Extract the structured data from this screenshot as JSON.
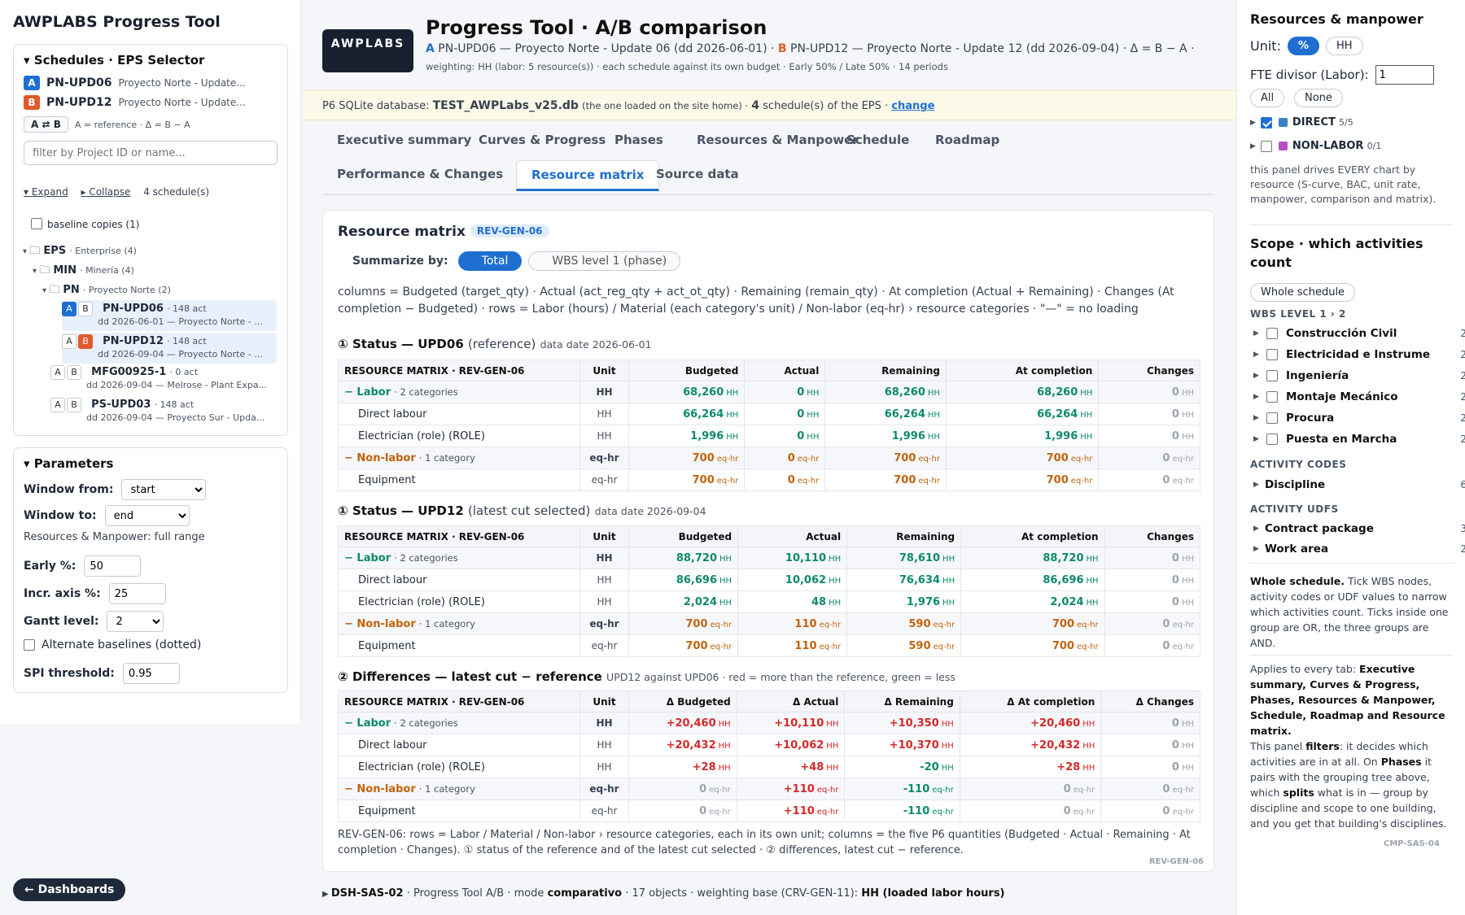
{
  "sidebar": {
    "app_title": "AWPLABS  Progress Tool",
    "schedules_title": "Schedules · EPS Selector",
    "sched_a": {
      "letter": "A",
      "id": "PN-UPD06",
      "name": "Proyecto Norte - Update..."
    },
    "sched_b": {
      "letter": "B",
      "id": "PN-UPD12",
      "name": "Proyecto Norte - Update..."
    },
    "swap_label": "A ⇄ B",
    "swap_legend": "A = reference · Δ = B − A",
    "filter_placeholder": "filter by Project ID or name...",
    "expand": "▾ Expand",
    "collapse": "▸ Collapse",
    "count": "4 schedule(s)",
    "baseline_copies": "baseline copies (1)",
    "tree": {
      "eps": {
        "name": "EPS",
        "sub": "· Enterprise (4)"
      },
      "min": {
        "name": "MIN",
        "sub": "· Minería (4)"
      },
      "pn": {
        "name": "PN",
        "sub": "· Proyecto Norte (2)"
      },
      "items": [
        {
          "id": "PN-UPD06",
          "acts": "· 148 act",
          "line2": "dd 2026-06-01 — Proyecto Norte - ..."
        },
        {
          "id": "PN-UPD12",
          "acts": "· 148 act",
          "line2": "dd 2026-09-04 — Proyecto Norte - ..."
        },
        {
          "id": "MFG00925-1",
          "acts": "· 0 act",
          "line2": "dd 2026-09-04 — Melrose - Plant Expa..."
        },
        {
          "id": "PS-UPD03",
          "acts": "· 148 act",
          "line2": "dd 2026-09-04 — Proyecto Sur - Upda..."
        }
      ]
    },
    "params_title": "Parameters",
    "window_from_label": "Window from:",
    "window_from_value": "start",
    "window_to_label": "Window to:",
    "window_to_value": "end",
    "range_note": "Resources & Manpower: full range",
    "early_label": "Early %:",
    "early_value": "50",
    "incr_label": "Incr. axis %:",
    "incr_value": "25",
    "gantt_label": "Gantt level:",
    "gantt_value": "2",
    "alt_baselines": "Alternate baselines (dotted)",
    "spi_label": "SPI threshold:",
    "spi_value": "0.95",
    "dashboards": "← Dashboards"
  },
  "header": {
    "logo": "AWPLABS",
    "title": "Progress Tool · A/B comparison",
    "sub_a_letter": "A",
    "sub_a": "PN-UPD06 — Proyecto Norte - Update 06 (dd 2026-06-01) ·",
    "sub_b_letter": "B",
    "sub_b": "PN-UPD12 — Proyecto Norte - Update 12 (dd 2026-09-04) · Δ = B − A ·",
    "sub2": "weighting: HH (labor: 5 resource(s)) · each schedule against its own budget · Early 50% / Late 50% · 14 periods",
    "db_prefix": "P6 SQLite database:",
    "db_name": "TEST_AWPLabs_v25.db",
    "db_note": "(the one loaded on the site home) ·",
    "db_count": "4",
    "db_count_suffix": "schedule(s) of the EPS ·",
    "db_change": "change"
  },
  "tabs": [
    "Executive summary",
    "Curves & Progress",
    "Phases",
    "Resources & Manpower",
    "Schedule",
    "Roadmap",
    "Performance & Changes",
    "Resource matrix",
    "Source data"
  ],
  "matrix": {
    "title": "Resource matrix",
    "tag": "REV-GEN-06",
    "summarize_label": "Summarize by:",
    "opt_total": "Total",
    "opt_wbs": "WBS level 1 (phase)",
    "desc": "columns = Budgeted (target_qty) · Actual (act_reg_qty + act_ot_qty) · Remaining (remain_qty) · At completion (Actual + Remaining) · Changes (At completion − Budgeted) · rows = Labor (hours) / Material (each category's unit) / Non-labor (eq-hr) › resource categories · \"—\" = no loading",
    "sec1": {
      "num": "①",
      "title": "Status — UPD06",
      "paren": "(reference)",
      "meta": "data date 2026-06-01"
    },
    "sec2": {
      "num": "①",
      "title": "Status — UPD12",
      "paren": "(latest cut selected)",
      "meta": "data date 2026-09-04"
    },
    "sec3": {
      "num": "②",
      "title": "Differences — latest cut − reference",
      "paren": "",
      "meta": "UPD12 against UPD06 · red = more than the reference, green = less"
    },
    "headers_status": [
      "RESOURCE MATRIX · REV-GEN-06",
      "Unit",
      "Budgeted",
      "Actual",
      "Remaining",
      "At completion",
      "Changes"
    ],
    "headers_diff": [
      "RESOURCE MATRIX · REV-GEN-06",
      "Unit",
      "Δ Budgeted",
      "Δ Actual",
      "Δ Remaining",
      "Δ At completion",
      "Δ Changes"
    ],
    "table1": [
      {
        "kind": "grp",
        "cls": "lab",
        "name": "Labor",
        "sub": "· 2 categories",
        "unit": "HH",
        "vals": [
          "68,260",
          "0",
          "68,260",
          "68,260",
          "0"
        ],
        "u": "HH",
        "colors": [
          "lab",
          "lab",
          "lab",
          "lab",
          "zero"
        ]
      },
      {
        "kind": "row",
        "name": "Direct labour",
        "unit": "HH",
        "vals": [
          "66,264",
          "0",
          "66,264",
          "66,264",
          "0"
        ],
        "u": "HH",
        "colors": [
          "lab",
          "lab",
          "lab",
          "lab",
          "zero"
        ]
      },
      {
        "kind": "row",
        "name": "Electrician (role) (ROLE)",
        "unit": "HH",
        "vals": [
          "1,996",
          "0",
          "1,996",
          "1,996",
          "0"
        ],
        "u": "HH",
        "colors": [
          "lab",
          "lab",
          "lab",
          "lab",
          "zero"
        ]
      },
      {
        "kind": "grp",
        "cls": "non",
        "name": "Non-labor",
        "sub": "· 1 category",
        "unit": "eq-hr",
        "vals": [
          "700",
          "0",
          "700",
          "700",
          "0"
        ],
        "u": "eq-hr",
        "colors": [
          "non",
          "non",
          "non",
          "non",
          "zero"
        ]
      },
      {
        "kind": "row",
        "name": "Equipment",
        "unit": "eq-hr",
        "vals": [
          "700",
          "0",
          "700",
          "700",
          "0"
        ],
        "u": "eq-hr",
        "colors": [
          "non",
          "non",
          "non",
          "non",
          "zero"
        ]
      }
    ],
    "table2": [
      {
        "kind": "grp",
        "cls": "lab",
        "name": "Labor",
        "sub": "· 2 categories",
        "unit": "HH",
        "vals": [
          "88,720",
          "10,110",
          "78,610",
          "88,720",
          "0"
        ],
        "u": "HH",
        "colors": [
          "lab",
          "lab",
          "lab",
          "lab",
          "zero"
        ]
      },
      {
        "kind": "row",
        "name": "Direct labour",
        "unit": "HH",
        "vals": [
          "86,696",
          "10,062",
          "76,634",
          "86,696",
          "0"
        ],
        "u": "HH",
        "colors": [
          "lab",
          "lab",
          "lab",
          "lab",
          "zero"
        ]
      },
      {
        "kind": "row",
        "name": "Electrician (role) (ROLE)",
        "unit": "HH",
        "vals": [
          "2,024",
          "48",
          "1,976",
          "2,024",
          "0"
        ],
        "u": "HH",
        "colors": [
          "lab",
          "lab",
          "lab",
          "lab",
          "zero"
        ]
      },
      {
        "kind": "grp",
        "cls": "non",
        "name": "Non-labor",
        "sub": "· 1 category",
        "unit": "eq-hr",
        "vals": [
          "700",
          "110",
          "590",
          "700",
          "0"
        ],
        "u": "eq-hr",
        "colors": [
          "non",
          "non",
          "non",
          "non",
          "zero"
        ]
      },
      {
        "kind": "row",
        "name": "Equipment",
        "unit": "eq-hr",
        "vals": [
          "700",
          "110",
          "590",
          "700",
          "0"
        ],
        "u": "eq-hr",
        "colors": [
          "non",
          "non",
          "non",
          "non",
          "zero"
        ]
      }
    ],
    "table3": [
      {
        "kind": "grp",
        "cls": "lab",
        "name": "Labor",
        "sub": "· 2 categories",
        "unit": "HH",
        "vals": [
          "+20,460",
          "+10,110",
          "+10,350",
          "+20,460",
          "0"
        ],
        "u": "HH",
        "colors": [
          "red",
          "red",
          "red",
          "red",
          "zero"
        ]
      },
      {
        "kind": "row",
        "name": "Direct labour",
        "unit": "HH",
        "vals": [
          "+20,432",
          "+10,062",
          "+10,370",
          "+20,432",
          "0"
        ],
        "u": "HH",
        "colors": [
          "red",
          "red",
          "red",
          "red",
          "zero"
        ]
      },
      {
        "kind": "row",
        "name": "Electrician (role) (ROLE)",
        "unit": "HH",
        "vals": [
          "+28",
          "+48",
          "-20",
          "+28",
          "0"
        ],
        "u": "HH",
        "colors": [
          "red",
          "red",
          "grn",
          "red",
          "zero"
        ]
      },
      {
        "kind": "grp",
        "cls": "non",
        "name": "Non-labor",
        "sub": "· 1 category",
        "unit": "eq-hr",
        "vals": [
          "0",
          "+110",
          "-110",
          "0",
          "0"
        ],
        "u": "eq-hr",
        "colors": [
          "zero",
          "red",
          "grn",
          "zero",
          "zero"
        ]
      },
      {
        "kind": "row",
        "name": "Equipment",
        "unit": "eq-hr",
        "vals": [
          "0",
          "+110",
          "-110",
          "0",
          "0"
        ],
        "u": "eq-hr",
        "colors": [
          "zero",
          "red",
          "grn",
          "zero",
          "zero"
        ]
      }
    ],
    "foot": "REV-GEN-06: rows = Labor / Material / Non-labor › resource categories, each in its own unit; columns = the five P6 quantities (Budgeted · Actual · Remaining · At completion · Changes). ① status of the reference and of the latest cut selected · ② differences, latest cut − reference.",
    "card_tag": "REV-GEN-06"
  },
  "bottom": {
    "code": "DSH-SAS-02",
    "text1": "· Progress Tool A/B · mode",
    "mode": "comparativo",
    "text2": "· 17 objects · weighting base (CRV-GEN-11):",
    "base": "HH (loaded labor hours)"
  },
  "right": {
    "title": "Resources & manpower",
    "unit_label": "Unit:",
    "unit_pct": "%",
    "unit_hh": "HH",
    "fte_label": "FTE divisor (Labor):",
    "fte_value": "1",
    "all": "All",
    "none": "None",
    "direct": {
      "name": "DIRECT",
      "count": "5/5",
      "color": "#3b82c4"
    },
    "nonlabor": {
      "name": "NON-LABOR",
      "count": "0/1",
      "color": "#b84fc4"
    },
    "note": "this panel drives EVERY chart by resource (S-curve, BAC, unit rate, manpower, comparison and matrix).",
    "scope_title": "Scope · which activities count",
    "whole_btn": "Whole schedule",
    "wbs_label": "WBS LEVEL 1 › 2",
    "wbs": [
      {
        "name": "Construcción Civil",
        "count": "2"
      },
      {
        "name": "Electricidad e Instrume",
        "count": "2"
      },
      {
        "name": "Ingeniería",
        "count": "2"
      },
      {
        "name": "Montaje Mecánico",
        "count": "2"
      },
      {
        "name": "Procura",
        "count": "2"
      },
      {
        "name": "Puesta en Marcha",
        "count": "2"
      }
    ],
    "codes_label": "ACTIVITY CODES",
    "discipline": {
      "name": "Discipline",
      "count": "6"
    },
    "udfs_label": "ACTIVITY UDFS",
    "contract": {
      "name": "Contract package",
      "count": "3"
    },
    "workarea": {
      "name": "Work area",
      "count": "2"
    },
    "whole_text_bold": "Whole schedule.",
    "whole_text": "Tick WBS nodes, activity codes or UDF values to narrow which activities count. Ticks inside one group are OR, the three groups are AND.",
    "applies": "Applies to every tab:",
    "applies_tabs": "Executive summary, Curves & Progress, Phases, Resources & Manpower, Schedule, Roadmap and Resource matrix.",
    "filters_text_a": "This panel",
    "filters_bold": "filters",
    "filters_text_b": ": it decides which activities are in at all. On",
    "phases_bold": "Phases",
    "filters_text_c": "it pairs with the grouping tree above, which",
    "splits_bold": "splits",
    "filters_text_d": "what is in — group by discipline and scope to one building, and you get that building's disciplines.",
    "tag": "CMP-SAS-04"
  }
}
